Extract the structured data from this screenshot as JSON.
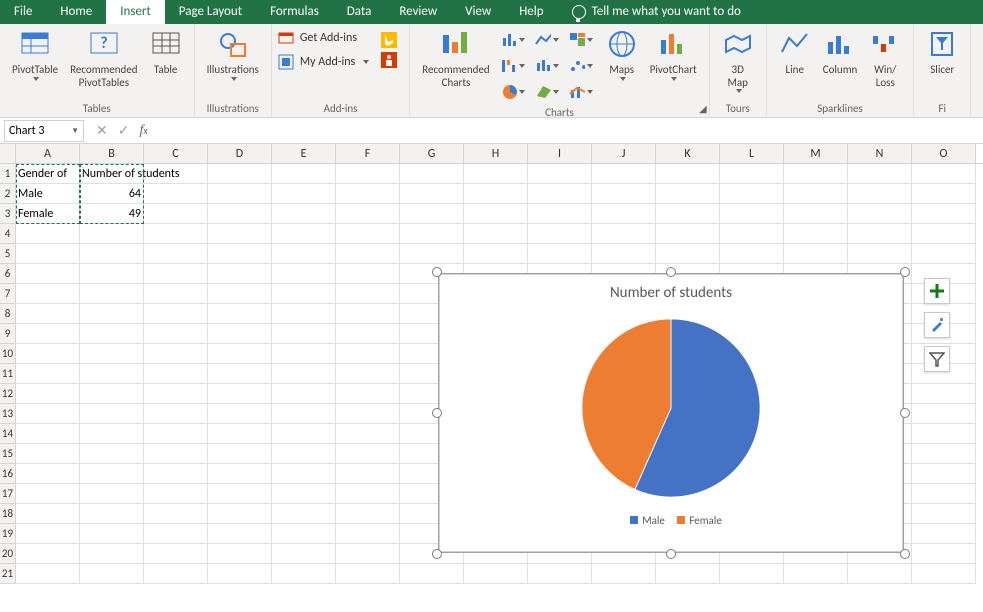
{
  "tabs": {
    "file": "File",
    "home": "Home",
    "insert": "Insert",
    "page_layout": "Page Layout",
    "formulas": "Formulas",
    "data": "Data",
    "review": "Review",
    "view": "View",
    "help": "Help",
    "tell": "Tell me what you want to do"
  },
  "ribbon": {
    "tables": {
      "label": "Tables",
      "pivottable": "PivotTable",
      "rec_pivot": "Recommended\nPivotTables",
      "table": "Table"
    },
    "illustrations": {
      "label": "Illustrations",
      "btn": "Illustrations"
    },
    "addins": {
      "label": "Add-ins",
      "get": "Get Add-ins",
      "my": "My Add-ins"
    },
    "charts": {
      "label": "Charts",
      "recommended": "Recommended\nCharts",
      "maps": "Maps",
      "pivotchart": "PivotChart"
    },
    "tours": {
      "label": "Tours",
      "map3d": "3D\nMap"
    },
    "sparklines": {
      "label": "Sparklines",
      "line": "Line",
      "column": "Column",
      "winloss": "Win/\nLoss"
    },
    "filters": {
      "label": "Fi",
      "slicer": "Slicer"
    }
  },
  "fx": {
    "namebox": "Chart 3",
    "formula": ""
  },
  "columns": [
    "A",
    "B",
    "C",
    "D",
    "E",
    "F",
    "G",
    "H",
    "I",
    "J",
    "K",
    "L",
    "M",
    "N",
    "O"
  ],
  "row_numbers": [
    "1",
    "2",
    "3",
    "4",
    "5",
    "6",
    "7",
    "8",
    "9",
    "10",
    "11",
    "12",
    "13",
    "14",
    "15",
    "16",
    "17",
    "18",
    "19",
    "20",
    "21"
  ],
  "sheet": {
    "a1": "Gender of",
    "b1": "Number of students",
    "a2": "Male",
    "b2": "64",
    "a3": "Female",
    "b3": "49"
  },
  "chart": {
    "title": "Number of students",
    "legend": {
      "male": "Male",
      "female": "Female"
    }
  },
  "colors": {
    "male": "#4472c4",
    "female": "#ed7d31"
  },
  "chart_data": {
    "type": "pie",
    "categories": [
      "Male",
      "Female"
    ],
    "values": [
      64,
      49
    ],
    "title": "Number of students",
    "series": [
      {
        "name": "Number of students",
        "values": [
          64,
          49
        ]
      }
    ]
  }
}
